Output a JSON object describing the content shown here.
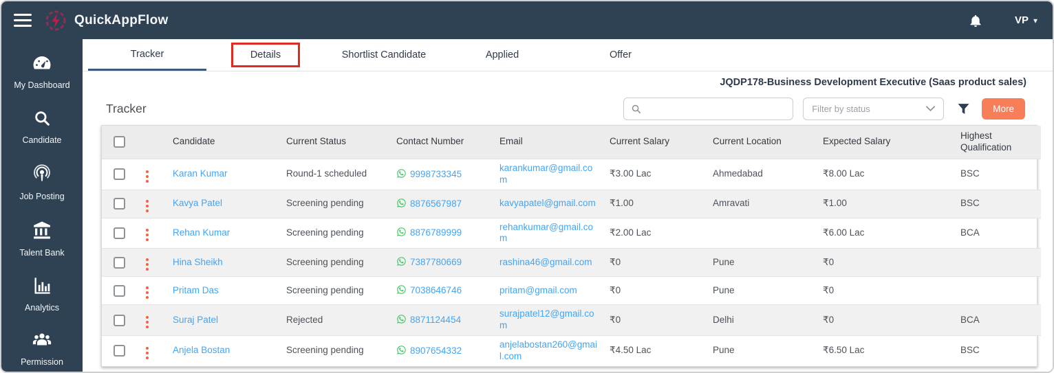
{
  "topbar": {
    "app_name": "QuickAppFlow",
    "user_initials": "VP",
    "user_caret": "▾"
  },
  "sidebar": {
    "items": [
      {
        "label": "My Dashboard",
        "icon": "dashboard-gauge-icon"
      },
      {
        "label": "Candidate",
        "icon": "search-icon"
      },
      {
        "label": "Job Posting",
        "icon": "podcast-icon"
      },
      {
        "label": "Talent Bank",
        "icon": "bank-icon"
      },
      {
        "label": "Analytics",
        "icon": "bar-chart-icon"
      },
      {
        "label": "Permission",
        "icon": "users-icon"
      }
    ]
  },
  "tabs": {
    "items": [
      {
        "label": "Tracker",
        "active": true,
        "highlighted": false
      },
      {
        "label": "Details",
        "active": false,
        "highlighted": true
      },
      {
        "label": "Shortlist Candidate",
        "active": false,
        "highlighted": false
      },
      {
        "label": "Applied",
        "active": false,
        "highlighted": false
      },
      {
        "label": "Offer",
        "active": false,
        "highlighted": false
      }
    ]
  },
  "job_header": "JQDP178-Business Development Executive (Saas product sales)",
  "controls": {
    "section_title": "Tracker",
    "search_placeholder": "",
    "filter_placeholder": "Filter by status",
    "filter_caret": "⌄",
    "more_label": "More"
  },
  "table": {
    "columns": [
      "Candidate",
      "Current Status",
      "Contact Number",
      "Email",
      "Current Salary",
      "Current Location",
      "Expected Salary",
      "Highest Qualification"
    ],
    "rows": [
      {
        "name": "Karan Kumar",
        "status": "Round-1 scheduled",
        "phone": "9998733345",
        "email": "karankumar@gmail.com",
        "current_salary": "₹3.00 Lac",
        "location": "Ahmedabad",
        "expected_salary": "₹8.00 Lac",
        "qualification": "BSC"
      },
      {
        "name": "Kavya Patel",
        "status": "Screening pending",
        "phone": "8876567987",
        "email": "kavyapatel@gmail.com",
        "current_salary": "₹1.00",
        "location": "Amravati",
        "expected_salary": "₹1.00",
        "qualification": "BSC"
      },
      {
        "name": "Rehan Kumar",
        "status": "Screening pending",
        "phone": "8876789999",
        "email": "rehankumar@gmail.com",
        "current_salary": "₹2.00 Lac",
        "location": "",
        "expected_salary": "₹6.00 Lac",
        "qualification": "BCA"
      },
      {
        "name": "Hina Sheikh",
        "status": "Screening pending",
        "phone": "7387780669",
        "email": "rashina46@gmail.com",
        "current_salary": "₹0",
        "location": "Pune",
        "expected_salary": "₹0",
        "qualification": ""
      },
      {
        "name": "Pritam Das",
        "status": "Screening pending",
        "phone": "7038646746",
        "email": "pritam@gmail.com",
        "current_salary": "₹0",
        "location": "Pune",
        "expected_salary": "₹0",
        "qualification": ""
      },
      {
        "name": "Suraj Patel",
        "status": "Rejected",
        "phone": "8871124454",
        "email": "surajpatel12@gmail.com",
        "current_salary": "₹0",
        "location": "Delhi",
        "expected_salary": "₹0",
        "qualification": "BCA"
      },
      {
        "name": "Anjela Bostan",
        "status": "Screening pending",
        "phone": "8907654332",
        "email": "anjelabostan260@gmail.com",
        "current_salary": "₹4.50 Lac",
        "location": "Pune",
        "expected_salary": "₹6.50 Lac",
        "qualification": "BSC"
      }
    ]
  },
  "colors": {
    "navy": "#2e4254",
    "active_tab_underline": "#3e5a7a",
    "link_blue": "#42a5f5",
    "whatsapp_green": "#3ec65e",
    "more_orange": "#f87e5a",
    "kebab_orange": "#f4623c",
    "annotation_red": "#e02b20",
    "header_gray": "#ececec",
    "stripe_gray": "#f1f1f1"
  }
}
